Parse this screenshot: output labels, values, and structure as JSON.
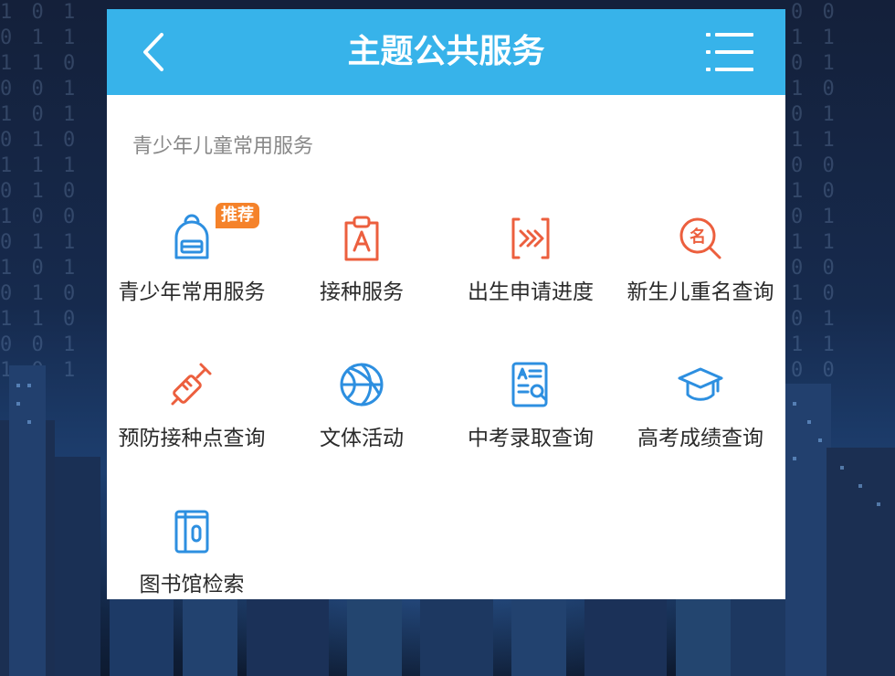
{
  "header": {
    "title": "主题公共服务"
  },
  "section": {
    "title": "青少年儿童常用服务"
  },
  "services": [
    {
      "label": "青少年常用服务",
      "icon": "backpack-icon",
      "badge": "推荐"
    },
    {
      "label": "接种服务",
      "icon": "vaccine-clipboard-icon"
    },
    {
      "label": "出生申请进度",
      "icon": "progress-arrows-icon"
    },
    {
      "label": "新生儿重名查询",
      "icon": "name-search-icon"
    },
    {
      "label": "预防接种点查询",
      "icon": "syringe-icon"
    },
    {
      "label": "文体活动",
      "icon": "basketball-icon"
    },
    {
      "label": "中考录取查询",
      "icon": "document-search-icon"
    },
    {
      "label": "高考成绩查询",
      "icon": "graduation-cap-icon"
    },
    {
      "label": "图书馆检索",
      "icon": "book-icon"
    }
  ],
  "colors": {
    "header_bg": "#37b3ea",
    "icon_orange": "#ec5f3e",
    "icon_blue": "#2d8fe0",
    "badge_bg": "#f5822a"
  }
}
